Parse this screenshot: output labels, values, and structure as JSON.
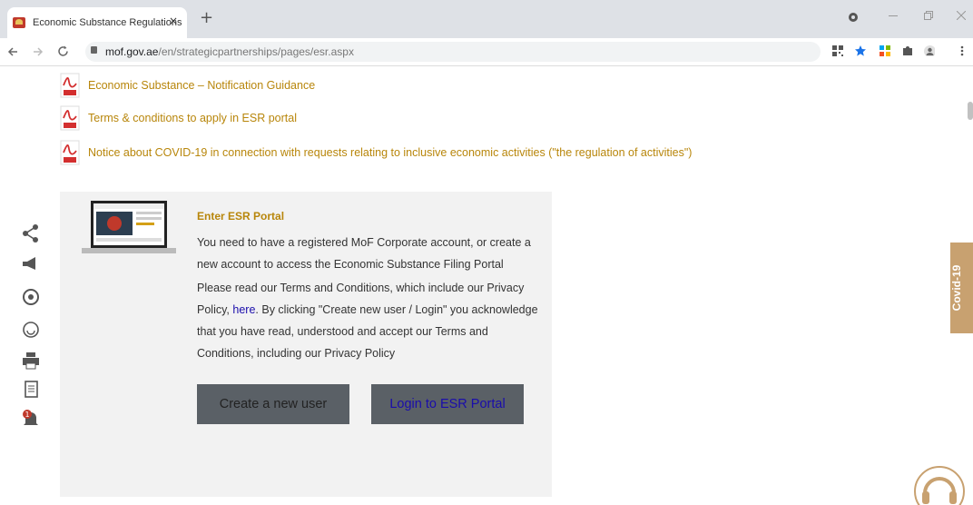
{
  "browser": {
    "tab_title": "Economic Substance Regulations",
    "tab_close": "×",
    "new_tab": "+",
    "url_host": "mof.gov.ae",
    "url_path": "/en/strategicpartnerships/pages/esr.aspx"
  },
  "documents": [
    {
      "label": "Economic Substance – Notification Guidance"
    },
    {
      "label": "Terms & conditions to apply in ESR portal"
    },
    {
      "label": "Notice about COVID-19 in connection with requests relating to inclusive economic activities (\"the regulation of activities\")"
    }
  ],
  "portal": {
    "title": "Enter ESR Portal",
    "intro": "You need to have a registered MoF Corporate account, or create a new account to access the Economic Substance Filing Portal",
    "terms_before": "Please read our Terms and Conditions, which include our Privacy Policy, ",
    "terms_link": "here",
    "terms_after": ". By clicking \"Create new user / Login\" you acknowledge that you have read, understood and accept our Terms and Conditions, including our Privacy Policy",
    "create_button": "Create a new user",
    "login_button": "Login to ESR Portal"
  },
  "side_tab": "Covid-19",
  "notification_count": "1",
  "colors": {
    "accent": "#b8860b",
    "link": "#1a0dab",
    "box": "#f2f2f2",
    "button": "#5a6066",
    "covid_tab": "#c8a170"
  }
}
